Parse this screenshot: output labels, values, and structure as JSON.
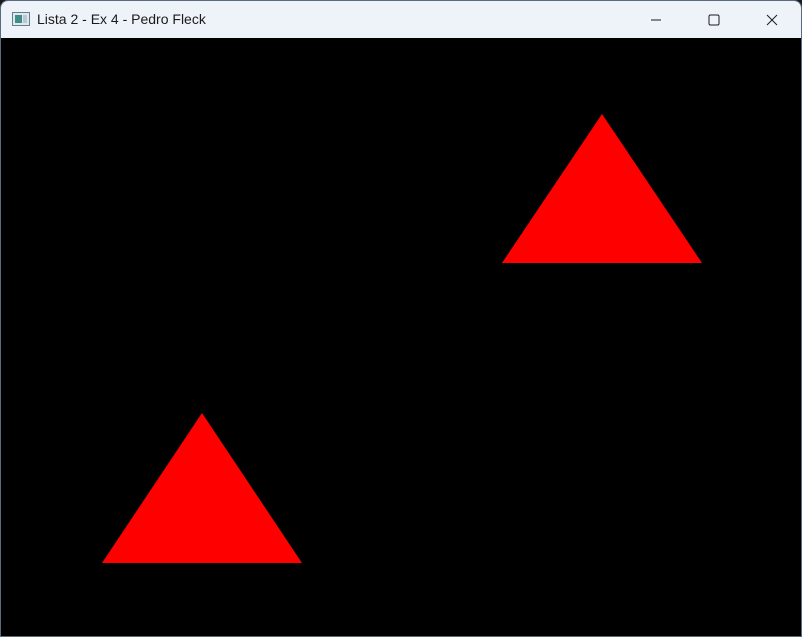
{
  "window": {
    "title": "Lista 2 - Ex 4 - Pedro Fleck",
    "icon": "app-window-icon",
    "controls": {
      "minimize_icon": "minimize-icon",
      "maximize_icon": "maximize-icon",
      "close_icon": "close-icon"
    }
  },
  "canvas": {
    "background_color": "#000000",
    "shapes": [
      {
        "type": "triangle",
        "color": "#ff0000"
      },
      {
        "type": "triangle",
        "color": "#ff0000"
      }
    ]
  }
}
